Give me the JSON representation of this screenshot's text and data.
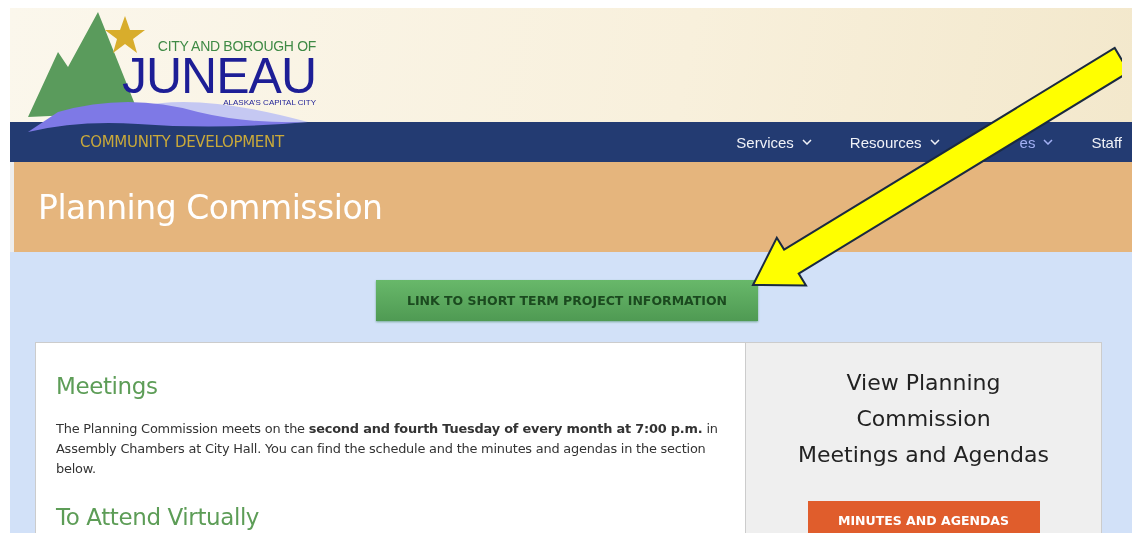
{
  "header": {
    "logo_line_1": "CITY AND BOROUGH OF",
    "logo_name": "JUNEAU",
    "logo_tagline": "ALASKA’S CAPITAL CITY",
    "department": "COMMUNITY DEVELOPMENT"
  },
  "nav": [
    {
      "label": "Services",
      "dropdown": true,
      "highlighted": false
    },
    {
      "label": "Resources",
      "dropdown": true,
      "highlighted": false
    },
    {
      "label": "es",
      "dropdown": true,
      "highlighted": true
    },
    {
      "label": "Staff",
      "dropdown": false,
      "highlighted": false
    }
  ],
  "page_title": "Planning Commission",
  "link_button": "LINK TO SHORT TERM PROJECT INFORMATION",
  "main": {
    "sections": [
      {
        "heading": "Meetings",
        "text": "The Planning Commission meets on the **second and fourth Tuesday of every month at 7:00 p.m.** in Assembly Chambers at City Hall. You can find the schedule and the minutes and agendas in the section below."
      },
      {
        "heading": "To Attend Virtually"
      }
    ]
  },
  "sidebar": {
    "heading_lines": [
      "View Planning",
      "Commission",
      "Meetings and Agendas"
    ],
    "button": "MINUTES AND AGENDAS"
  }
}
